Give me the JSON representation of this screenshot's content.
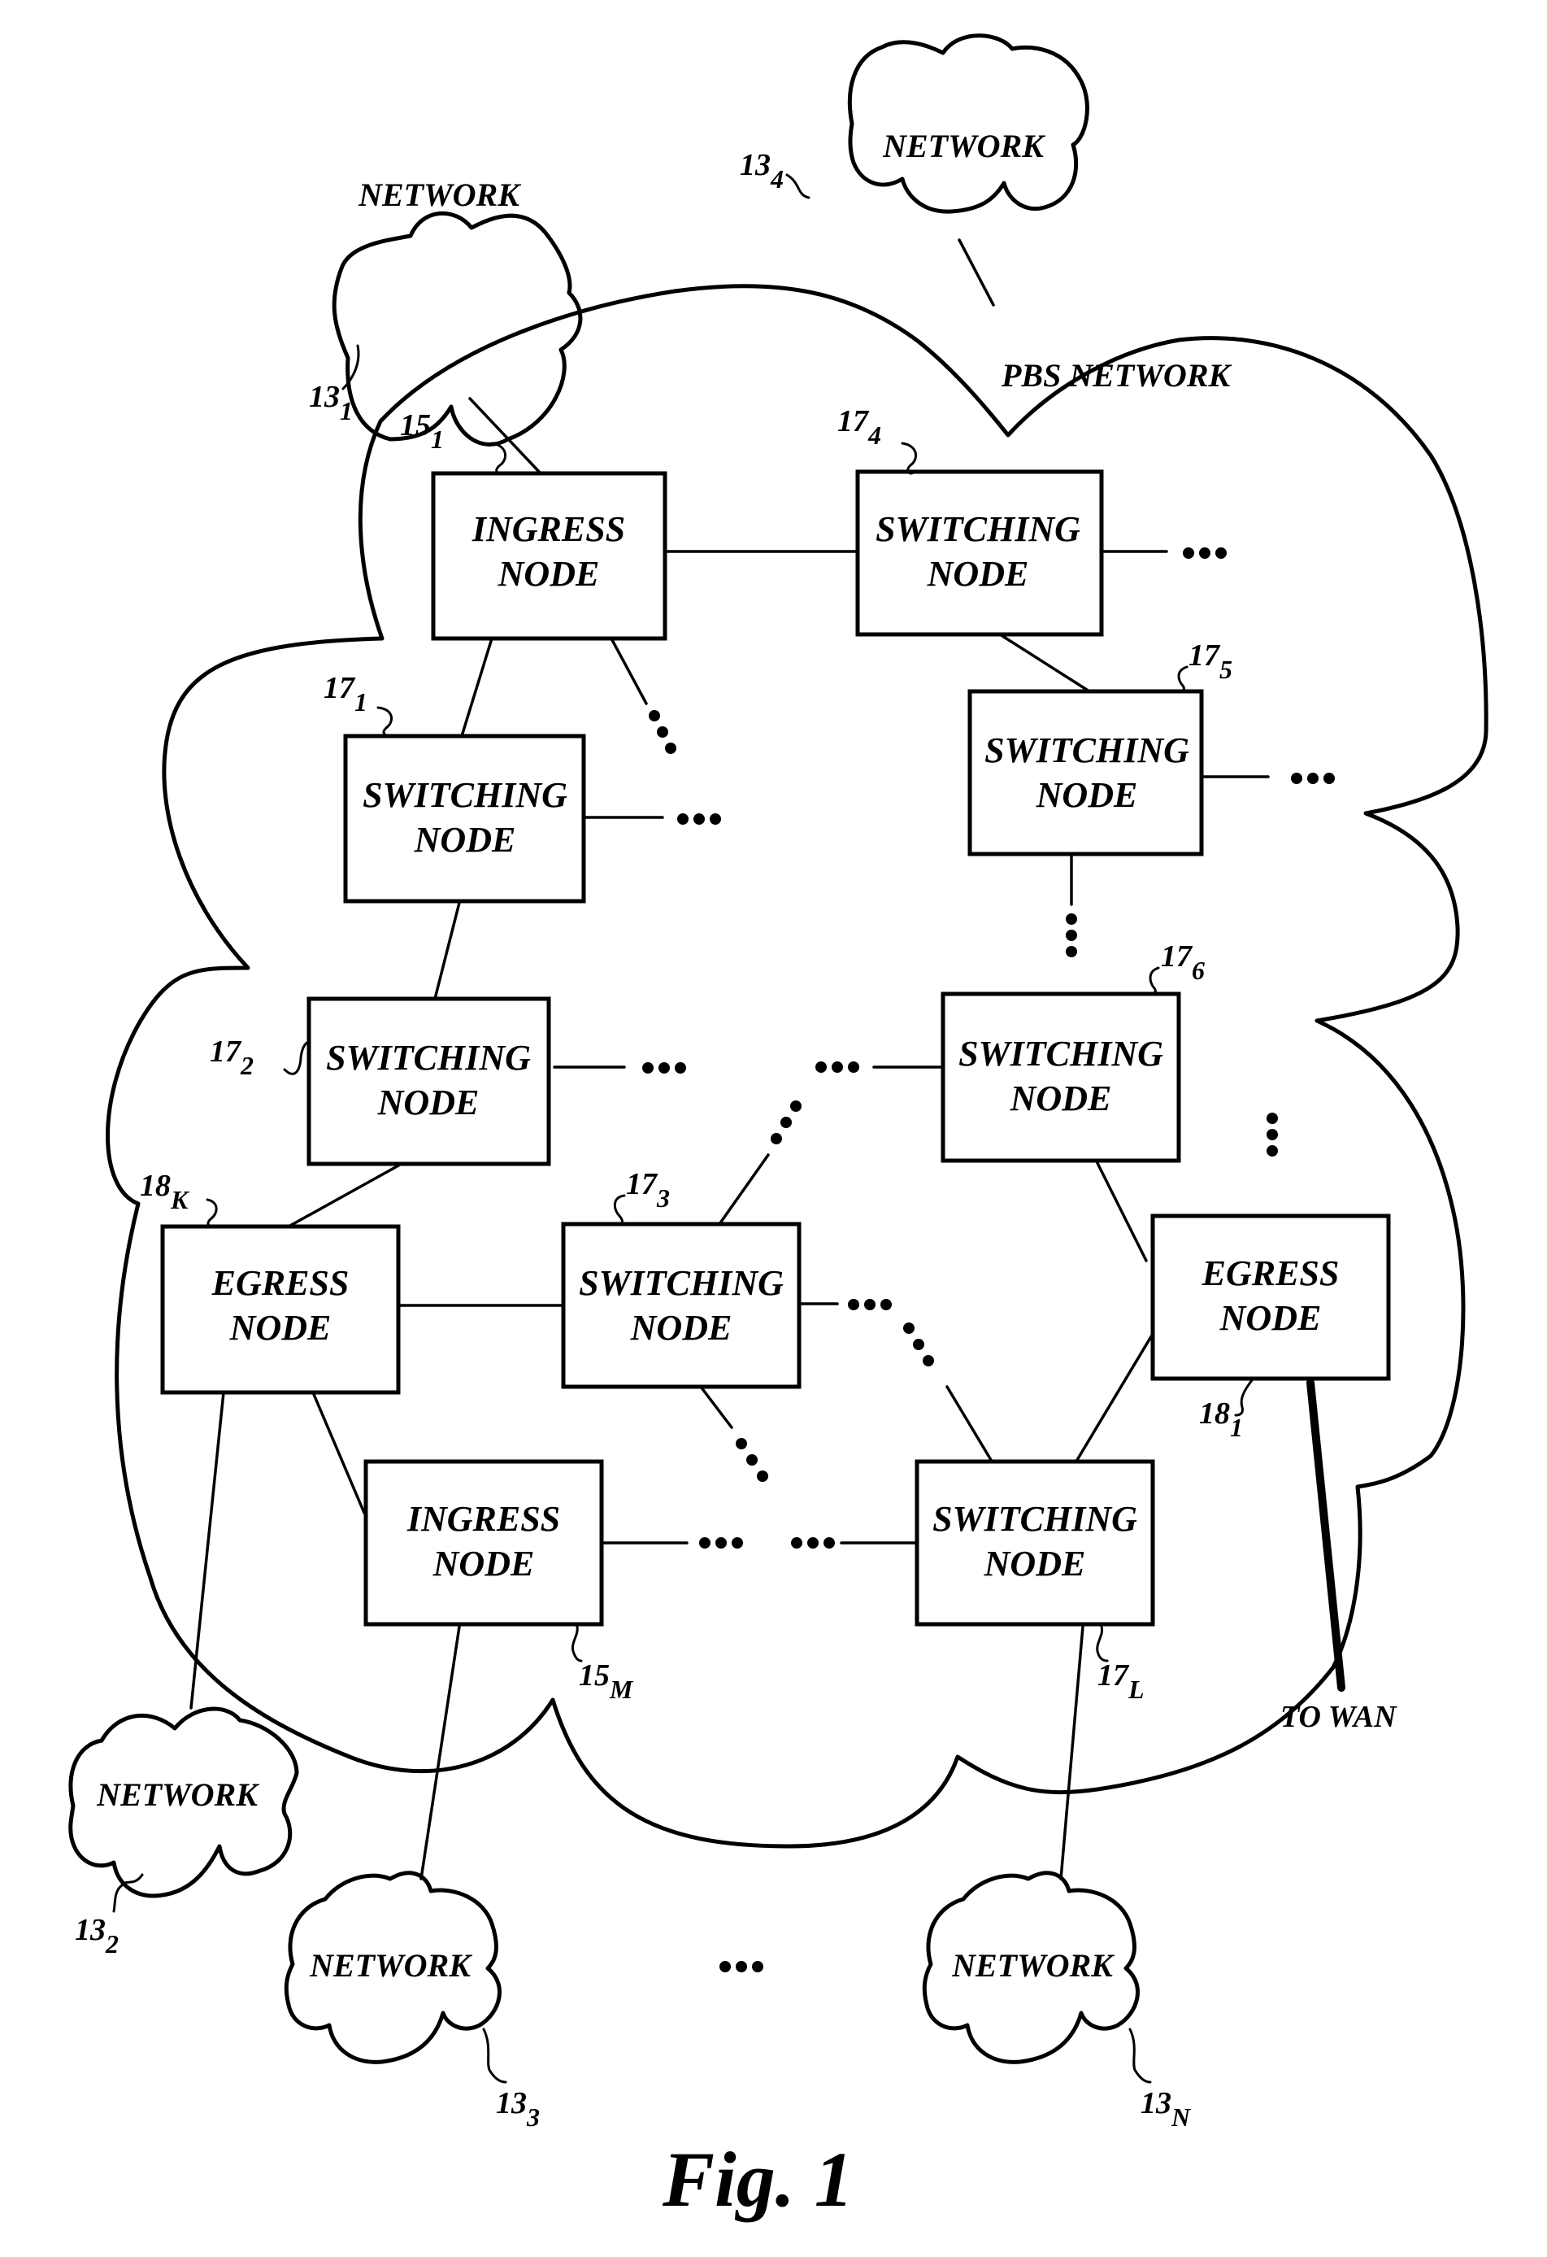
{
  "figure": {
    "caption": "Fig. 1",
    "pbs_network_label": "PBS NETWORK",
    "to_wan_label": "TO WAN"
  },
  "external_networks": [
    {
      "id": "net_1",
      "label": "NETWORK",
      "ref": "13",
      "sub": "1"
    },
    {
      "id": "net_4",
      "label": "NETWORK",
      "ref": "13",
      "sub": "4"
    },
    {
      "id": "net_2",
      "label": "NETWORK",
      "ref": "13",
      "sub": "2"
    },
    {
      "id": "net_3",
      "label": "NETWORK",
      "ref": "13",
      "sub": "3"
    },
    {
      "id": "net_N",
      "label": "NETWORK",
      "ref": "13",
      "sub": "N"
    }
  ],
  "nodes": [
    {
      "id": "ingress_1",
      "line1": "INGRESS",
      "line2": "NODE",
      "ref": "15",
      "sub": "1"
    },
    {
      "id": "switch_4",
      "line1": "SWITCHING",
      "line2": "NODE",
      "ref": "17",
      "sub": "4"
    },
    {
      "id": "switch_1",
      "line1": "SWITCHING",
      "line2": "NODE",
      "ref": "17",
      "sub": "1"
    },
    {
      "id": "switch_5",
      "line1": "SWITCHING",
      "line2": "NODE",
      "ref": "17",
      "sub": "5"
    },
    {
      "id": "switch_2",
      "line1": "SWITCHING",
      "line2": "NODE",
      "ref": "17",
      "sub": "2"
    },
    {
      "id": "switch_6",
      "line1": "SWITCHING",
      "line2": "NODE",
      "ref": "17",
      "sub": "6"
    },
    {
      "id": "egress_K",
      "line1": "EGRESS",
      "line2": "NODE",
      "ref": "18",
      "sub": "K"
    },
    {
      "id": "switch_3",
      "line1": "SWITCHING",
      "line2": "NODE",
      "ref": "17",
      "sub": "3"
    },
    {
      "id": "egress_1",
      "line1": "EGRESS",
      "line2": "NODE",
      "ref": "18",
      "sub": "1"
    },
    {
      "id": "ingress_M",
      "line1": "INGRESS",
      "line2": "NODE",
      "ref": "15",
      "sub": "M"
    },
    {
      "id": "switch_L",
      "line1": "SWITCHING",
      "line2": "NODE",
      "ref": "17",
      "sub": "L"
    }
  ],
  "ellipsis_glyph": "•••"
}
